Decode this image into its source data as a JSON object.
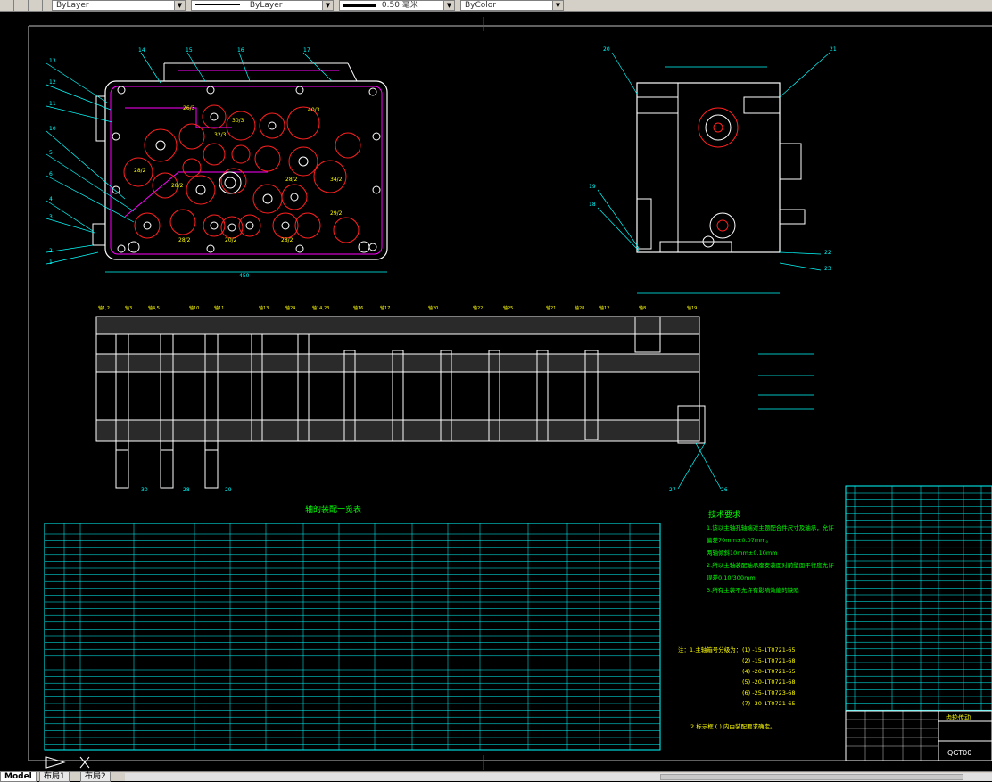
{
  "toolbar": {
    "layer_value": "ByLayer",
    "linetype_value": "ByLayer",
    "lineweight_value": "0.50 毫米",
    "color_value": "ByColor"
  },
  "drawing": {
    "table_title": "轴的装配一览表",
    "tech_title": "技术要求",
    "tech_lines": [
      "1.该以主轴孔轴端对主题配合件尺寸及轴承，允许",
      "偏差70mm±0.07mm。",
      "两轴倾斜10mm±0.10mm",
      "2.所以主轴装配轴承座安装面对前壁面平行度允许",
      "误差0.10/300mm",
      "3.所有主装不允许有影响效能的缺陷"
    ],
    "note_label": "注：1.主轴箱号分级为：",
    "note_items": [
      "(1) -15-1T0721-65",
      "(2) -15-1T0721-68",
      "(4) -20-1T0721-65",
      "(5) -20-1T0721-68",
      "(6) -25-1T0723-68",
      "(7) -30-1T0721-65"
    ],
    "note2": "2.标示框 ( ) 内由装配要求确定。",
    "title_block_text": "QGT00",
    "title_block_label": "齿轮传动"
  },
  "status": {
    "tabs": [
      "Model",
      "布局1",
      "布局2"
    ]
  },
  "colors": {
    "cyan": "#00ffff",
    "magenta": "#ff00ff",
    "red": "#ff2020",
    "green": "#00ff00",
    "yellow": "#ffff00",
    "white": "#ffffff",
    "blue": "#4040ff"
  }
}
